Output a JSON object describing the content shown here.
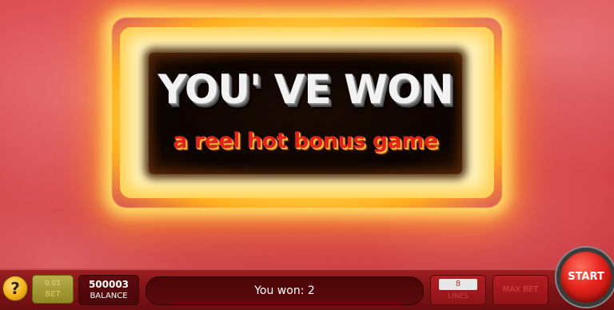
{
  "banner": {
    "headline": "YOU' VE WON",
    "subline": "a reel hot bonus game"
  },
  "bottom_bar": {
    "help_label": "?",
    "bet": {
      "value": "0.01",
      "label": "BET"
    },
    "balance": {
      "value": "500003",
      "label": "BALANCE"
    },
    "message": "You won: 2",
    "lines": {
      "value": "8",
      "label": "LINES"
    },
    "max_bet_label": "MAX BET",
    "start_label": "START"
  },
  "colors": {
    "background": "#c93238",
    "fire": "#ffe46a",
    "subline": "#e0241c",
    "start_button": "#e3241c"
  }
}
